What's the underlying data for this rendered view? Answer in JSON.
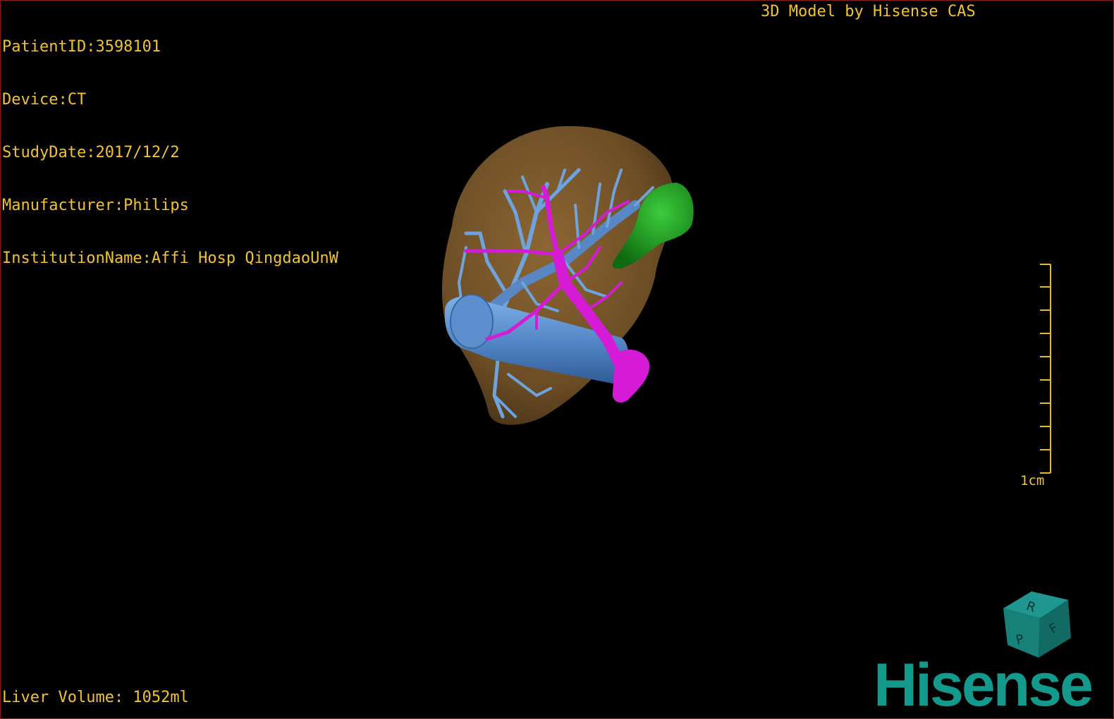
{
  "overlay": {
    "patient_id": "PatientID:3598101",
    "device": "Device:CT",
    "study_date": "StudyDate:2017/12/2",
    "manufacturer": "Manufacturer:Philips",
    "institution": "InstitutionName:Affi Hosp QingdaoUnW",
    "credit": "3D Model by Hisense CAS",
    "liver_volume": "Liver Volume: 1052ml"
  },
  "scale_bar": {
    "label": "1cm"
  },
  "orientation_cube": {
    "faces": [
      "R",
      "F",
      "P"
    ],
    "color": "#1a7f7a"
  },
  "brand": {
    "logo_text": "Hisense",
    "color": "#139a8d"
  },
  "colors": {
    "text": "#f2c230",
    "liver": "#7d5b2c",
    "portal_vein": "#5a8fd0",
    "hepatic_artery": "#d21ad2",
    "gallbladder": "#1f9e1f",
    "border": "#8a1c1c"
  }
}
